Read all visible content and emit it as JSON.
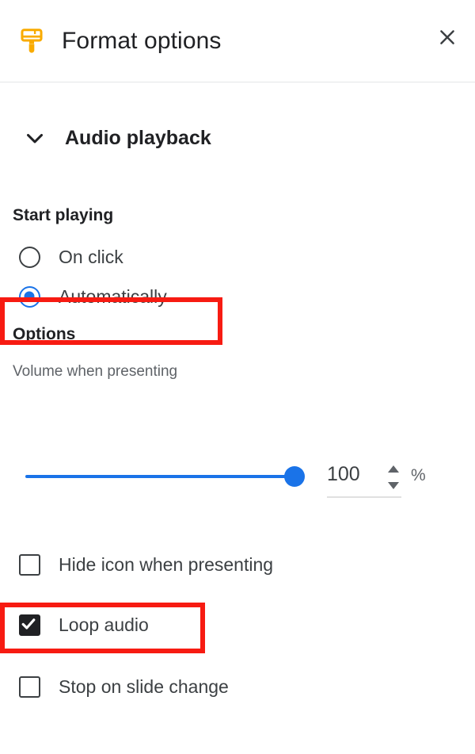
{
  "header": {
    "title": "Format options",
    "brush_icon": "paint-brush-icon",
    "close_icon": "close-icon"
  },
  "section": {
    "title": "Audio playback",
    "chevron_icon": "chevron-down-icon",
    "expanded": true
  },
  "start_playing": {
    "label": "Start playing",
    "options": [
      {
        "label": "On click",
        "selected": false
      },
      {
        "label": "Automatically",
        "selected": true
      }
    ],
    "highlighted_option": "Automatically"
  },
  "options": {
    "label": "Options",
    "volume": {
      "label": "Volume when presenting",
      "value": "100",
      "unit": "%",
      "min": 0,
      "max": 100,
      "spinner_up_icon": "triangle-up-icon",
      "spinner_down_icon": "triangle-down-icon"
    },
    "checkboxes": [
      {
        "label": "Hide icon when presenting",
        "checked": false,
        "highlighted": false
      },
      {
        "label": "Loop audio",
        "checked": true,
        "highlighted": true
      },
      {
        "label": "Stop on slide change",
        "checked": false,
        "highlighted": false
      }
    ]
  },
  "colors": {
    "accent": "#1a73e8",
    "brush": "#f9ab00",
    "highlight": "#f71b12",
    "text_primary": "#202124",
    "text_secondary": "#5f6368",
    "checked_box": "#202124"
  }
}
